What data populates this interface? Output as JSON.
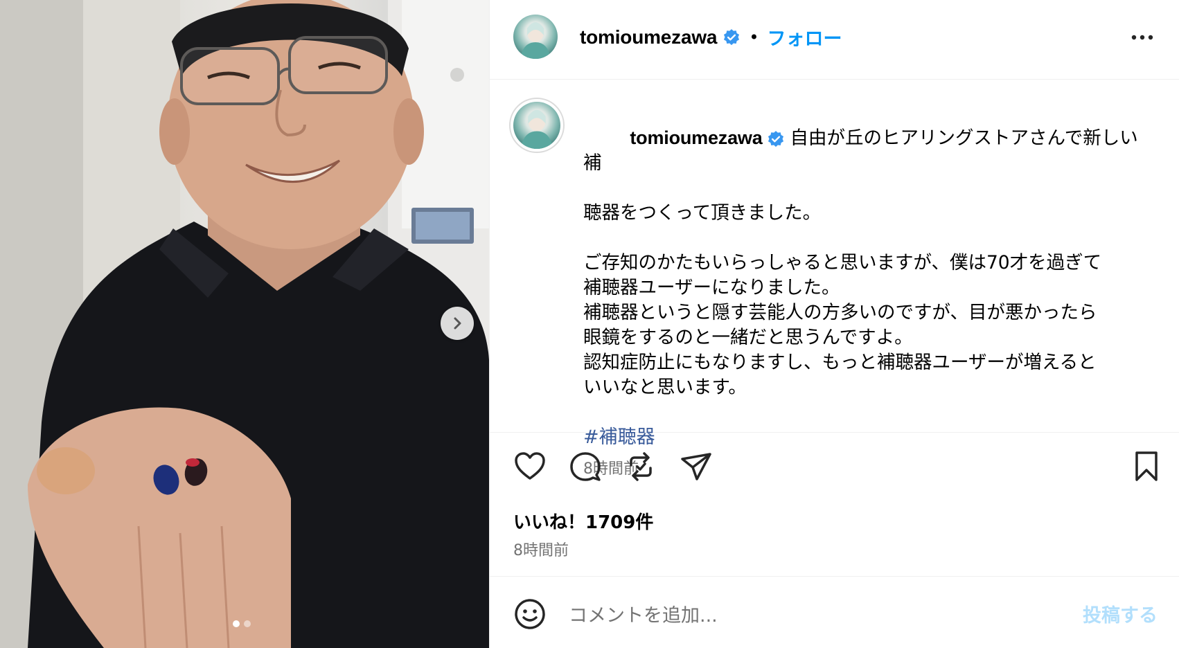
{
  "post": {
    "username": "tomioumezawa",
    "follow_label": "フォロー",
    "separator": "•",
    "more_label": "その他のオプション",
    "caption": {
      "line1": "自由が丘のヒアリングストアさんで新しい補",
      "line2": "聴器をつくって頂きました。",
      "para2": "ご存知のかたもいらっしゃると思いますが、僕は70才を過ぎて\n補聴器ユーザーになりました。\n補聴器というと隠す芸能人の方多いのですが、目が悪かったら\n眼鏡をするのと一緒だと思うんですよ。\n認知症防止にもなりますし、もっと補聴器ユーザーが増えると\nいいなと思います。",
      "hashtag": "#補聴器",
      "time": "8時間前"
    },
    "likes": "いいね！1709件",
    "time": "8時間前"
  },
  "carousel": {
    "count": 2,
    "active_index": 0
  },
  "comment": {
    "placeholder": "コメントを追加...",
    "post_label": "投稿する"
  },
  "icons": [
    "heart-icon",
    "comment-icon",
    "repost-icon",
    "share-icon",
    "bookmark-icon",
    "emoji-icon",
    "verified-badge-icon",
    "more-icon",
    "chevron-right-icon"
  ],
  "colors": {
    "accent": "#0095f6",
    "verified": "#3897f0",
    "hashtag": "#385a9a",
    "post_disabled": "#b2dffc",
    "secondary_text": "#737373"
  }
}
